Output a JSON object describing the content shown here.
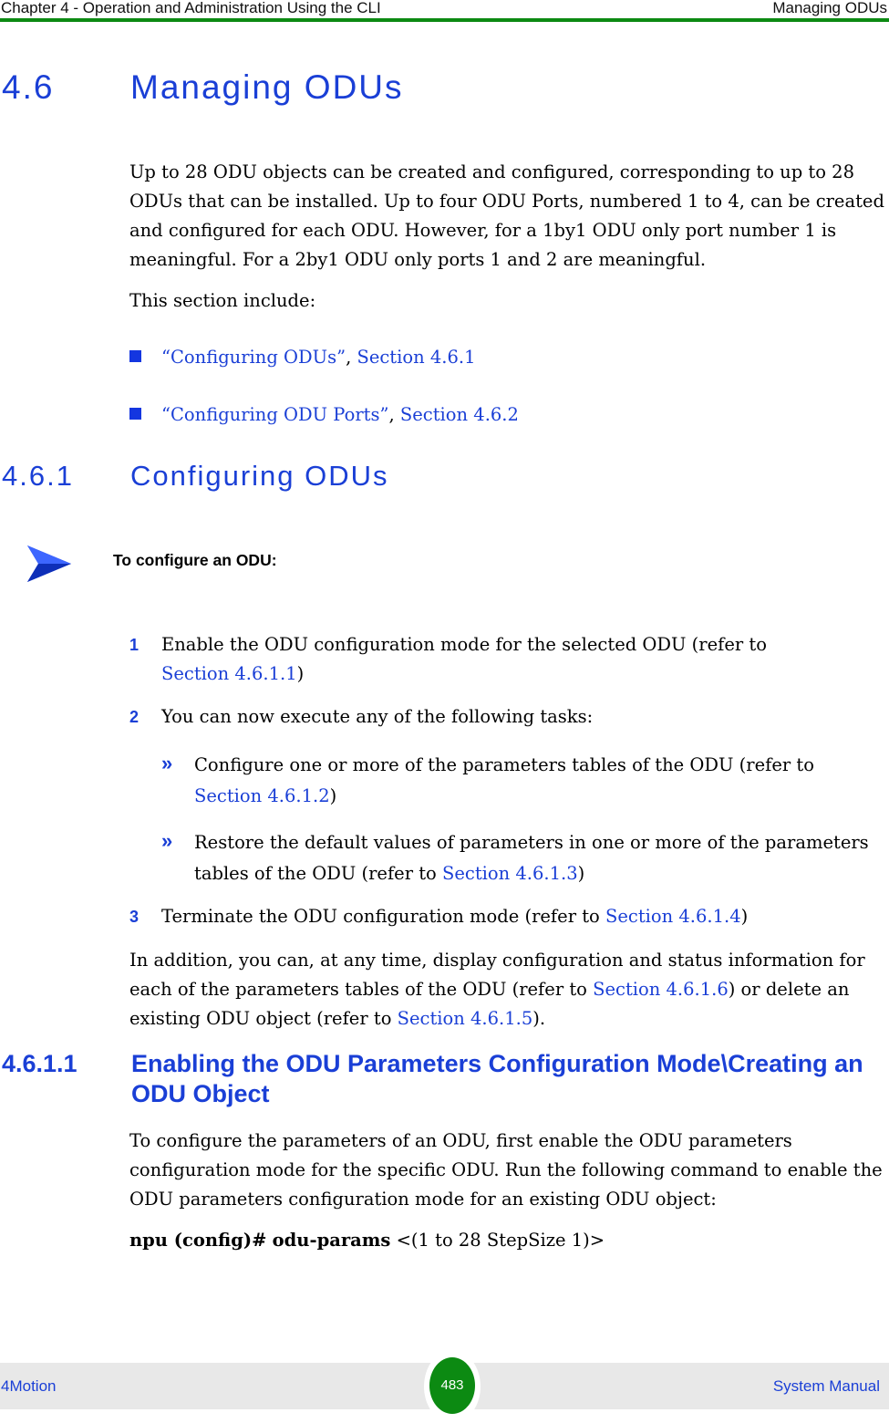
{
  "header": {
    "chapter": "Chapter 4 - Operation and Administration Using the CLI",
    "section": "Managing ODUs",
    "rule_color": "#0c8a12"
  },
  "section_4_6": {
    "number": "4.6",
    "title": "Managing ODUs",
    "intro": "Up to 28 ODU objects can be created and configured, corresponding to up to 28 ODUs that can be installed. Up to four ODU Ports, numbered 1 to 4, can be created and configured for each ODU. However, for a 1by1 ODU only port number 1 is meaningful. For a 2by1 ODU only ports 1 and 2 are meaningful.",
    "includes_label": "This section include:",
    "includes": [
      {
        "link_text": "“Configuring ODUs”",
        "separator": ", ",
        "section_ref": "Section 4.6.1"
      },
      {
        "link_text": "“Configuring ODU Ports”",
        "separator": ", ",
        "section_ref": "Section 4.6.2"
      }
    ]
  },
  "section_4_6_1": {
    "number": "4.6.1",
    "title": "Configuring ODUs",
    "procedure_icon": "arrow-right-icon",
    "procedure_label": "To configure an ODU:",
    "steps": [
      {
        "num": "1",
        "text": "Enable the ODU configuration mode for the selected ODU (refer to ",
        "ref": "Section 4.6.1.1",
        "tail": ")"
      },
      {
        "num": "2",
        "text": "You can now execute any of the following tasks:"
      },
      {
        "num": "3",
        "text": "Terminate the ODU configuration mode (refer to ",
        "ref": "Section 4.6.1.4",
        "tail": ")"
      }
    ],
    "subtasks": [
      {
        "marker": "»",
        "text": "Configure one or more of the parameters tables of the ODU (refer to ",
        "ref": "Section 4.6.1.2",
        "tail": ")"
      },
      {
        "marker": "»",
        "text": "Restore the default values of parameters in one or more of the parameters tables of the ODU (refer to ",
        "ref": "Section 4.6.1.3",
        "tail": ")"
      }
    ],
    "addition": {
      "part1": "In addition, you can, at any time, display configuration and status information for each of the parameters tables of the ODU (refer to ",
      "ref1": "Section 4.6.1.6",
      "part2": ") or delete an existing ODU object (refer to ",
      "ref2": "Section 4.6.1.5",
      "part3": ")."
    }
  },
  "section_4_6_1_1": {
    "number": "4.6.1.1",
    "title": "Enabling the ODU Parameters Configuration Mode\\Creating an ODU Object",
    "body": "To configure the parameters of an ODU, first enable the ODU parameters configuration mode for the specific ODU. Run the following command to enable the ODU parameters configuration mode for an existing ODU object:",
    "command": {
      "prompt": "npu (config)#",
      "keyword": "odu-params",
      "argument": "<(1 to 28 StepSize 1)>"
    }
  },
  "footer": {
    "product": "4Motion",
    "page_number": "483",
    "doc_title": "System Manual",
    "badge_color": "#0c8a12"
  }
}
